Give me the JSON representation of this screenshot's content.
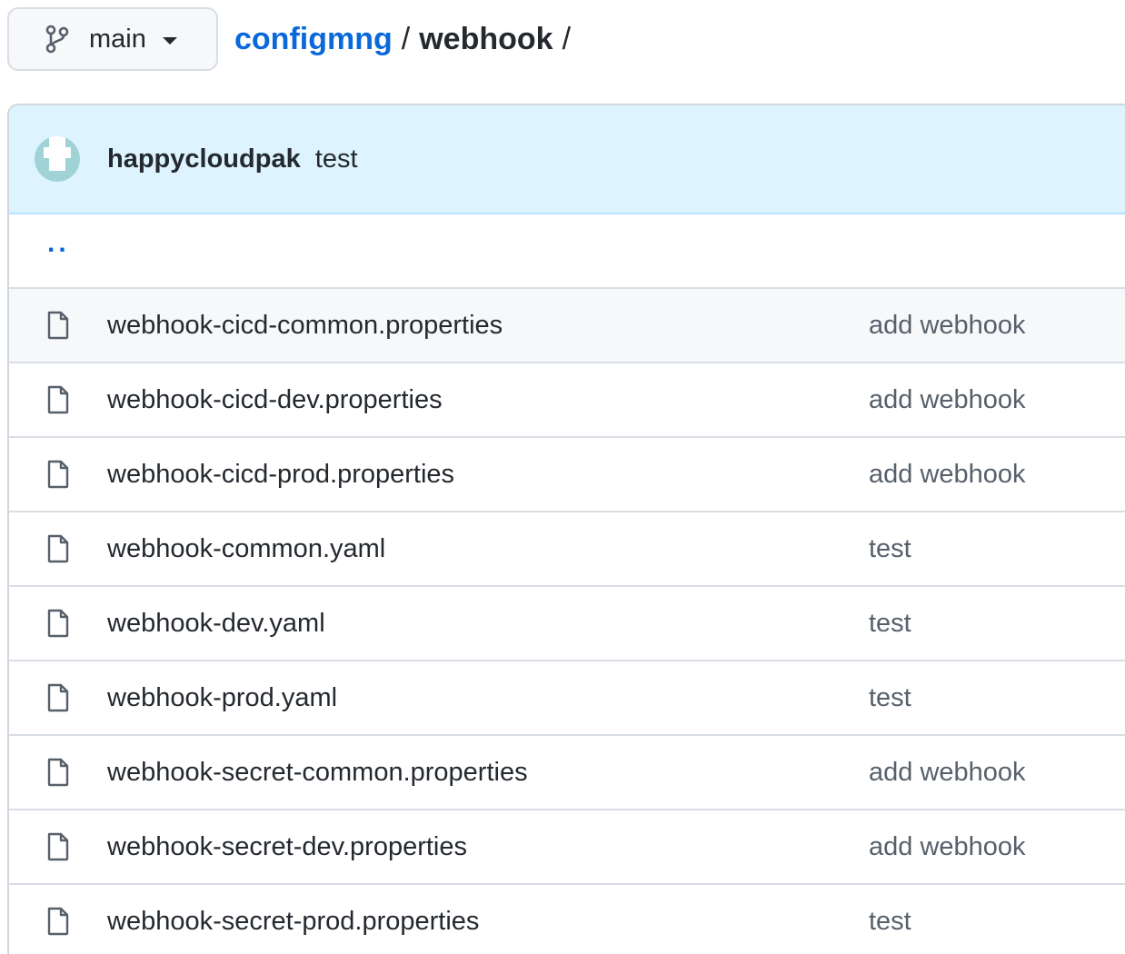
{
  "branch": {
    "label": "main",
    "icon": "git-branch-icon"
  },
  "breadcrumb": {
    "repo": "configmng",
    "separator": "/",
    "folder": "webhook",
    "trailing": "/"
  },
  "latest_commit": {
    "author": "happycloudpak",
    "message": "test",
    "avatar_color": "#9fd3d6"
  },
  "parent_dir": {
    "label": ".."
  },
  "files": [
    {
      "name": "webhook-cicd-common.properties",
      "commit": "add webhook",
      "icon": "file-icon"
    },
    {
      "name": "webhook-cicd-dev.properties",
      "commit": "add webhook",
      "icon": "file-icon"
    },
    {
      "name": "webhook-cicd-prod.properties",
      "commit": "add webhook",
      "icon": "file-icon"
    },
    {
      "name": "webhook-common.yaml",
      "commit": "test",
      "icon": "file-icon"
    },
    {
      "name": "webhook-dev.yaml",
      "commit": "test",
      "icon": "file-icon"
    },
    {
      "name": "webhook-prod.yaml",
      "commit": "test",
      "icon": "file-icon"
    },
    {
      "name": "webhook-secret-common.properties",
      "commit": "add webhook",
      "icon": "file-icon"
    },
    {
      "name": "webhook-secret-dev.properties",
      "commit": "add webhook",
      "icon": "file-icon"
    },
    {
      "name": "webhook-secret-prod.properties",
      "commit": "test",
      "icon": "file-icon"
    }
  ],
  "colors": {
    "link": "#0969da",
    "header_bg": "#ddf4ff",
    "muted_text": "#57606a"
  }
}
